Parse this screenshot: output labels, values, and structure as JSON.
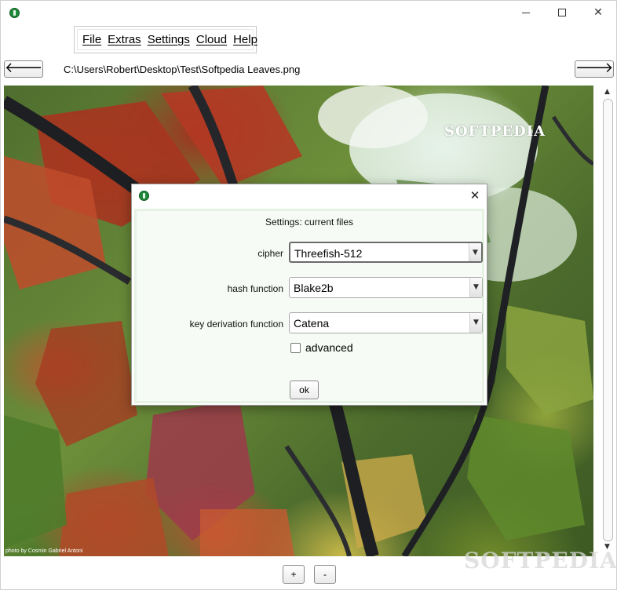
{
  "window": {
    "controls": {
      "minimize": "",
      "maximize": "",
      "close": "✕"
    }
  },
  "menu": {
    "items": [
      {
        "label": "File"
      },
      {
        "label": "Extras"
      },
      {
        "label": "Settings"
      },
      {
        "label": "Cloud"
      },
      {
        "label": "Help"
      }
    ]
  },
  "nav": {
    "back_label": "🡐",
    "forward_label": "🡒",
    "path": "C:\\Users\\Robert\\Desktop\\Test\\Softpedia Leaves.png"
  },
  "image": {
    "watermark": "SOFTPEDIA",
    "credit": "photo by Cosmin Gabriel Antoni"
  },
  "scrollbar": {
    "up": "▲",
    "down": "▼"
  },
  "zoom": {
    "in_label": "+",
    "out_label": "-"
  },
  "overlay_watermark": "SOFTPEDIA",
  "dialog": {
    "close": "✕",
    "header": "Settings: current files",
    "fields": [
      {
        "label": "cipher",
        "value": "Threefish-512"
      },
      {
        "label": "hash function",
        "value": "Blake2b"
      },
      {
        "label": "key derivation function",
        "value": "Catena"
      }
    ],
    "dropdown_arrow": "▼",
    "advanced": {
      "label": "advanced",
      "checked": false
    },
    "ok_label": "ok"
  },
  "colors": {
    "app_icon": "#1e8a3a",
    "dialog_body": "#f6fbf5"
  }
}
